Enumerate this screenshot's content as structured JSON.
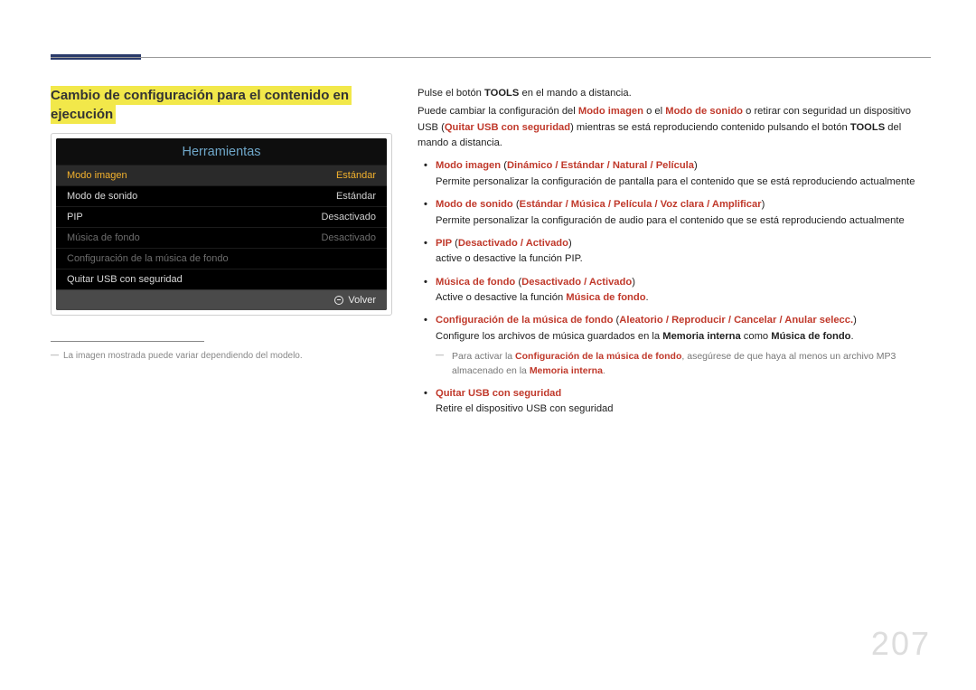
{
  "section_title_line1": "Cambio de configuración para el contenido en",
  "section_title_line2": "ejecución",
  "menu": {
    "title": "Herramientas",
    "rows": [
      {
        "label": "Modo imagen",
        "value": "Estándar",
        "state": "selected"
      },
      {
        "label": "Modo de sonido",
        "value": "Estándar",
        "state": "normal"
      },
      {
        "label": "PIP",
        "value": "Desactivado",
        "state": "normal"
      },
      {
        "label": "Música de fondo",
        "value": "Desactivado",
        "state": "dim"
      },
      {
        "label": "Configuración de la música de fondo",
        "value": "",
        "state": "dim"
      },
      {
        "label": "Quitar USB con seguridad",
        "value": "",
        "state": "normal"
      }
    ],
    "footer": "Volver"
  },
  "left_footnote": "La imagen mostrada puede variar dependiendo del modelo.",
  "intro": {
    "p1a": "Pulse el botón ",
    "p1b": "TOOLS",
    "p1c": " en el mando a distancia.",
    "p2a": "Puede cambiar la configuración del ",
    "p2b": "Modo imagen",
    "p2c": " o el ",
    "p2d": "Modo de sonido",
    "p2e": " o retirar con seguridad un dispositivo USB (",
    "p2f": "Quitar USB con seguridad",
    "p2g": ") mientras se está reproduciendo contenido pulsando el botón ",
    "p2h": "TOOLS",
    "p2i": " del mando a distancia."
  },
  "features": {
    "f1": {
      "title": "Modo imagen",
      "opts": "Dinámico / Estándar / Natural / Película",
      "desc": "Permite personalizar la configuración de pantalla para el contenido que se está reproduciendo actualmente"
    },
    "f2": {
      "title": "Modo de sonido",
      "opts": "Estándar / Música / Película / Voz clara / Amplificar",
      "desc": "Permite personalizar la configuración de audio para el contenido que se está reproduciendo actualmente"
    },
    "f3": {
      "title": "PIP",
      "opts": "Desactivado / Activado",
      "desc": "active o desactive la función PIP."
    },
    "f4": {
      "title": "Música de fondo",
      "opts": "Desactivado / Activado",
      "desc_a": "Active o desactive la función ",
      "desc_b": "Música de fondo",
      "desc_c": "."
    },
    "f5": {
      "title": "Configuración de la música de fondo",
      "opts": "Aleatorio / Reproducir / Cancelar / Anular selecc.",
      "desc_a": "Configure los archivos de música guardados en la ",
      "desc_b": "Memoria interna",
      "desc_c": " como ",
      "desc_d": "Música de fondo",
      "desc_e": ".",
      "note_a": "Para activar la ",
      "note_b": "Configuración de la música de fondo",
      "note_c": ", asegúrese de que haya al menos un archivo MP3 almacenado en la ",
      "note_d": "Memoria interna",
      "note_e": "."
    },
    "f6": {
      "title": "Quitar USB con seguridad",
      "desc": "Retire el dispositivo USB con seguridad"
    }
  },
  "page_number": "207"
}
